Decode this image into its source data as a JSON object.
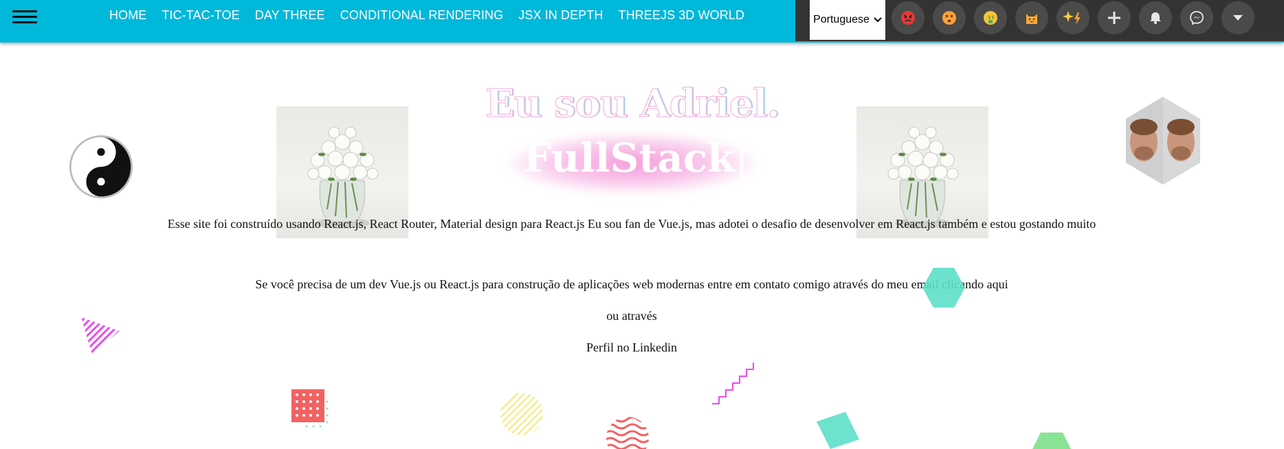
{
  "nav": {
    "menu_icon": "hamburger-menu-icon",
    "links": [
      "HOME",
      "TIC-TAC-TOE",
      "DAY THREE",
      "CONDITIONAL RENDERING",
      "JSX IN DEPTH",
      "THREEJS 3D WORLD"
    ]
  },
  "extension_bar": {
    "language": "Portuguese",
    "buttons": [
      {
        "name": "angry-emoji-icon"
      },
      {
        "name": "dizzy-emoji-icon"
      },
      {
        "name": "money-emoji-icon"
      },
      {
        "name": "cat-emoji-icon"
      },
      {
        "name": "sparkles-bolt-icon"
      },
      {
        "name": "plus-icon"
      },
      {
        "name": "bell-icon"
      },
      {
        "name": "messenger-icon"
      },
      {
        "name": "caret-down-icon"
      }
    ]
  },
  "hero": {
    "title": "Eu sou Adriel.",
    "subtitle": "FullStack",
    "cursor": "|"
  },
  "body": {
    "line1": "Esse site foi construído usando React.js, React Router, Material design para React.js Eu sou fan de Vue.js, mas adotei o desafio de desenvolver em React.js também e estou gostando muito",
    "line2": "Se você precisa de um dev Vue.js ou React.js para construção de aplicações web modernas entre em contato comigo através do meu email clicando aqui",
    "line3": "ou através",
    "line4": "Perfil no Linkedin"
  },
  "colors": {
    "topbar": "#00b8d9",
    "extension_bar": "#333333",
    "title_outline": "#f3a8d9",
    "glow": "#f48cd6"
  }
}
